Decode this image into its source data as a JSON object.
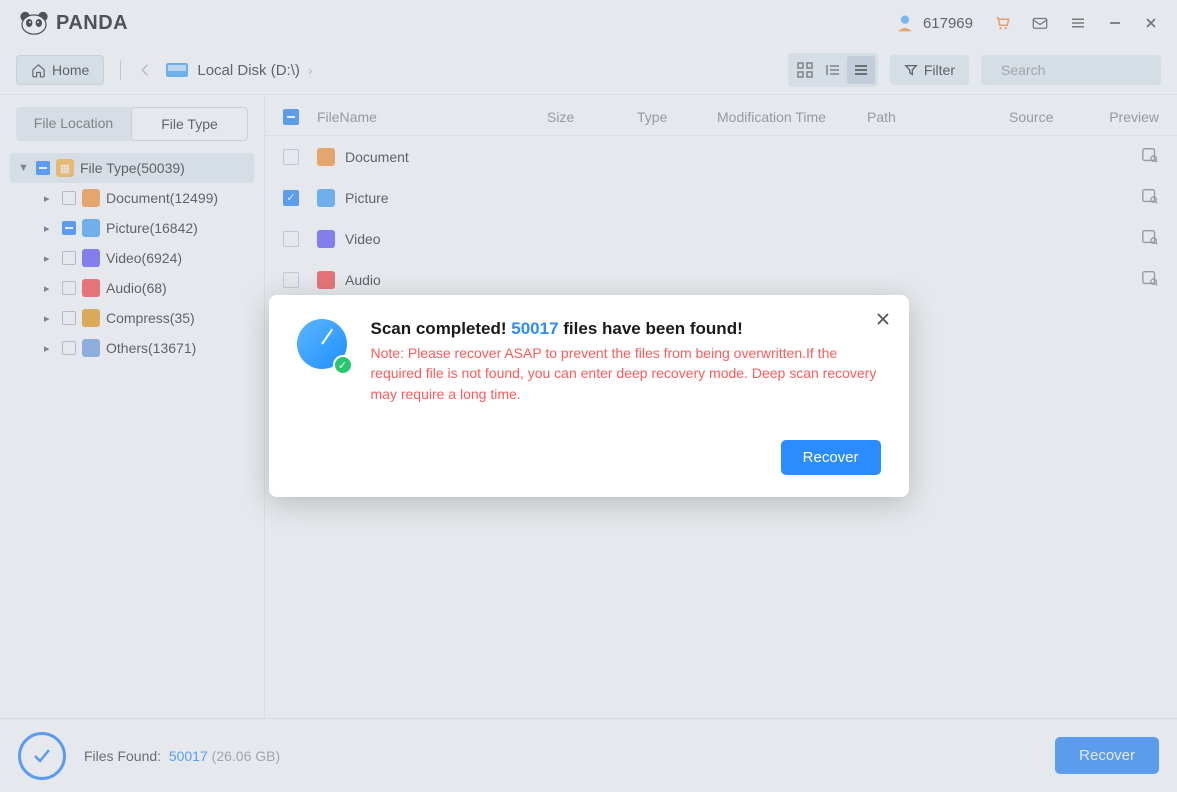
{
  "brand": {
    "name": "PANDA"
  },
  "header": {
    "user_id": "617969"
  },
  "toolbar": {
    "home_label": "Home",
    "breadcrumb_label": "Local Disk (D:\\)",
    "filter_label": "Filter",
    "search_placeholder": "Search"
  },
  "sidebar": {
    "tabs": {
      "location": "File Location",
      "type": "File Type"
    },
    "root": {
      "label": "File Type(50039)"
    },
    "items": [
      {
        "label": "Document(12499)",
        "icon": "ico-doc"
      },
      {
        "label": "Picture(16842)",
        "icon": "ico-pic",
        "checked": "part"
      },
      {
        "label": "Video(6924)",
        "icon": "ico-vid"
      },
      {
        "label": "Audio(68)",
        "icon": "ico-aud"
      },
      {
        "label": "Compress(35)",
        "icon": "ico-comp"
      },
      {
        "label": "Others(13671)",
        "icon": "ico-oth"
      }
    ]
  },
  "table": {
    "columns": {
      "name": "FileName",
      "size": "Size",
      "type": "Type",
      "mod": "Modification Time",
      "path": "Path",
      "source": "Source",
      "preview": "Preview"
    },
    "rows": [
      {
        "label": "Document",
        "icon": "ico-doc",
        "checked": false
      },
      {
        "label": "Picture",
        "icon": "ico-pic",
        "checked": true
      },
      {
        "label": "Video",
        "icon": "ico-vid",
        "checked": false
      },
      {
        "label": "Audio",
        "icon": "ico-aud",
        "checked": false
      }
    ]
  },
  "footer": {
    "label": "Files Found:",
    "count": "50017",
    "size": "(26.06 GB)",
    "recover_label": "Recover"
  },
  "modal": {
    "title_prefix": "Scan completed! ",
    "title_count": "50017",
    "title_suffix": " files have been found!",
    "note": "Note: Please recover ASAP to prevent the files from being overwritten.If the required file is not found, you can enter deep recovery mode. Deep scan recovery may require a long time.",
    "recover_label": "Recover"
  }
}
